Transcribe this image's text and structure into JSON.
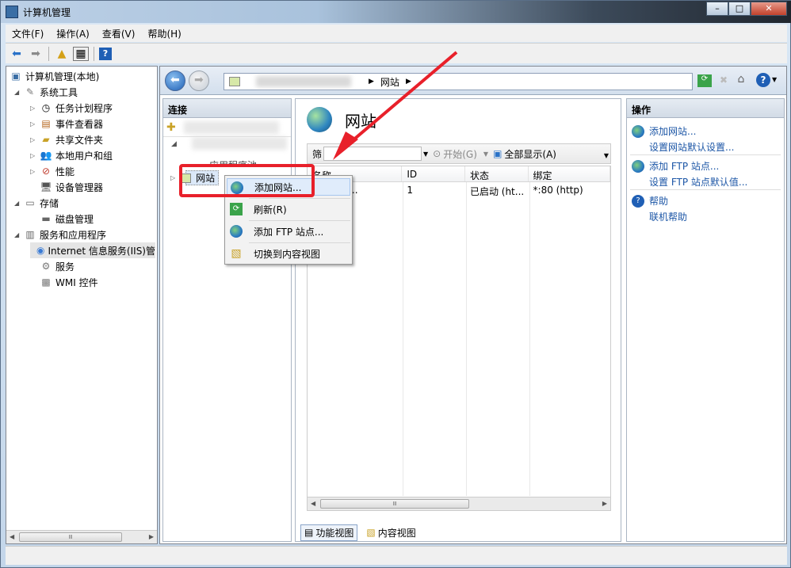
{
  "window": {
    "title": "计算机管理"
  },
  "menu": [
    "文件(F)",
    "操作(A)",
    "查看(V)",
    "帮助(H)"
  ],
  "tree": [
    {
      "label": "计算机管理(本地)",
      "level": 0,
      "toggle": "",
      "icon": "computer-icon"
    },
    {
      "label": "系统工具",
      "level": 1,
      "toggle": "◢",
      "icon": "tools-icon"
    },
    {
      "label": "任务计划程序",
      "level": 2,
      "toggle": "▷",
      "icon": "clock-icon"
    },
    {
      "label": "事件查看器",
      "level": 2,
      "toggle": "▷",
      "icon": "event-viewer-icon"
    },
    {
      "label": "共享文件夹",
      "level": 2,
      "toggle": "▷",
      "icon": "shared-folder-icon"
    },
    {
      "label": "本地用户和组",
      "level": 2,
      "toggle": "▷",
      "icon": "users-icon"
    },
    {
      "label": "性能",
      "level": 2,
      "toggle": "▷",
      "icon": "performance-icon"
    },
    {
      "label": "设备管理器",
      "level": 2,
      "toggle": "",
      "icon": "device-manager-icon"
    },
    {
      "label": "存储",
      "level": 1,
      "toggle": "◢",
      "icon": "storage-icon"
    },
    {
      "label": "磁盘管理",
      "level": 2,
      "toggle": "",
      "icon": "disk-icon"
    },
    {
      "label": "服务和应用程序",
      "level": 1,
      "toggle": "◢",
      "icon": "services-apps-icon"
    },
    {
      "label": "Internet 信息服务(IIS)管",
      "level": 2,
      "toggle": "",
      "icon": "iis-icon"
    },
    {
      "label": "服务",
      "level": 2,
      "toggle": "",
      "icon": "gear-icon"
    },
    {
      "label": "WMI 控件",
      "level": 2,
      "toggle": "",
      "icon": "wmi-icon"
    }
  ],
  "address": {
    "segment": "网站"
  },
  "connections": {
    "title": "连接",
    "app_pools": "应用程序池",
    "sites": "网站"
  },
  "page": {
    "title": "网站"
  },
  "filter": {
    "label": "筛",
    "start": "开始(G)",
    "showall": "全部显示(A)"
  },
  "grid": {
    "columns": [
      "名称",
      "ID",
      "状态",
      "绑定"
    ],
    "rows": [
      [
        "Default Web S...",
        "1",
        "已启动 (ht...",
        "*:80 (http)"
      ]
    ],
    "name_visible": "t Web S..."
  },
  "views": {
    "feature": "功能视图",
    "content": "内容视图"
  },
  "actions": {
    "title": "操作",
    "items": [
      "添加网站...",
      "设置网站默认设置...",
      "添加 FTP 站点...",
      "设置 FTP 站点默认值...",
      "帮助",
      "联机帮助"
    ]
  },
  "context_menu": [
    "添加网站...",
    "刷新(R)",
    "添加 FTP 站点...",
    "切换到内容视图"
  ],
  "colors": {
    "accent": "#e8202a",
    "link": "#1c56a6"
  }
}
